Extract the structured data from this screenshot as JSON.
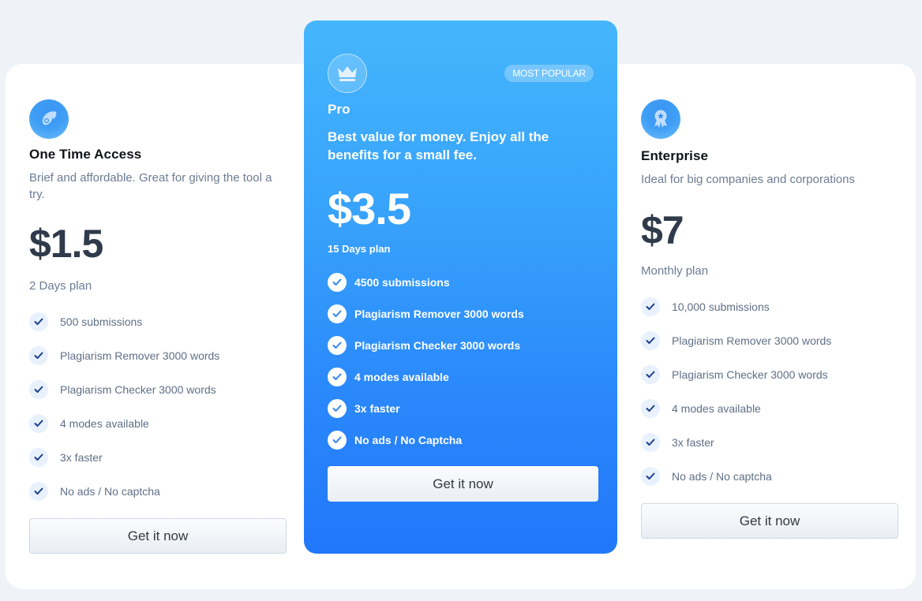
{
  "colors": {
    "page_bg": "#eff3f7",
    "accent_top": "#45b6fc",
    "accent_bottom": "#2277fa",
    "check_color": "#1b3f8f"
  },
  "plans": [
    {
      "icon": "rocket-icon",
      "title": "One Time Access",
      "description": "Brief and affordable. Great for giving the tool a try.",
      "price": "$1.5",
      "period": "2 Days plan",
      "features": [
        "500 submissions",
        "Plagiarism Remover 3000 words",
        "Plagiarism Checker 3000 words",
        "4 modes available",
        "3x faster",
        "No ads / No captcha"
      ],
      "cta": "Get it now"
    },
    {
      "icon": "crown-icon",
      "badge": "MOST POPULAR",
      "title": "Pro",
      "description": "Best value for money. Enjoy all the benefits for a small fee.",
      "price": "$3.5",
      "period": "15 Days plan",
      "features": [
        "4500 submissions",
        "Plagiarism Remover 3000 words",
        "Plagiarism Checker 3000 words",
        "4 modes available",
        "3x faster",
        "No ads / No Captcha"
      ],
      "cta": "Get it now"
    },
    {
      "icon": "award-medal-icon",
      "title": "Enterprise",
      "description": "Ideal for big companies and corporations",
      "price": "$7",
      "period": "Monthly plan",
      "features": [
        "10,000 submissions",
        "Plagiarism Remover 3000 words",
        "Plagiarism Checker 3000 words",
        "4 modes available",
        "3x faster",
        "No ads / No captcha"
      ],
      "cta": "Get it now"
    }
  ]
}
